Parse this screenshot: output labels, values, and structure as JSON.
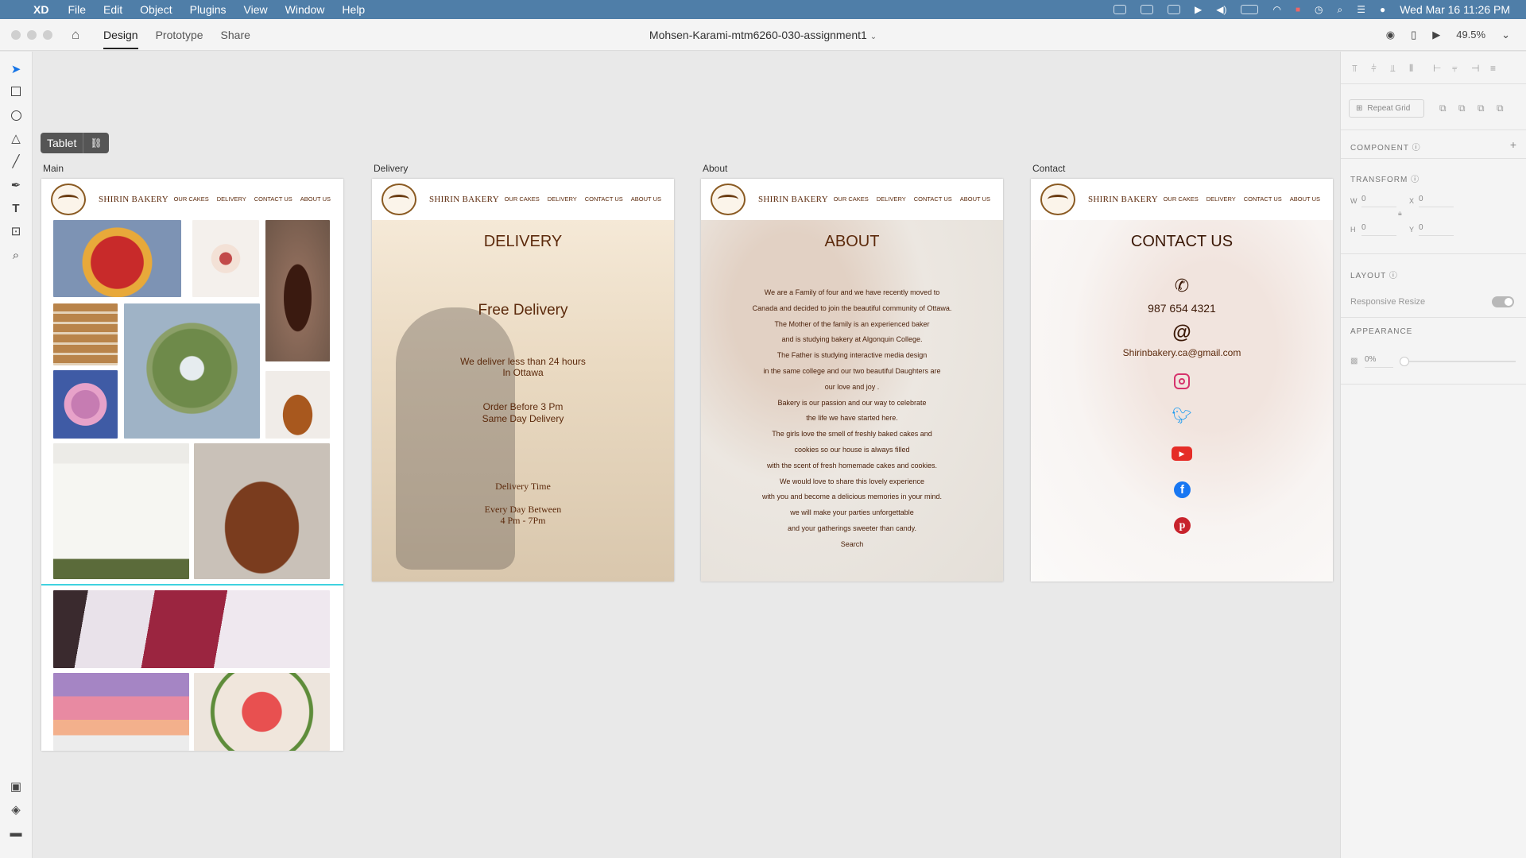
{
  "menubar": {
    "app": "XD",
    "items": [
      "File",
      "Edit",
      "Object",
      "Plugins",
      "View",
      "Window",
      "Help"
    ],
    "datetime": "Wed Mar 16  11:26 PM"
  },
  "toolbar": {
    "modes": [
      "Design",
      "Prototype",
      "Share"
    ],
    "doc_title": "Mohsen-Karami-mtm6260-030-assignment1",
    "zoom": "49.5%"
  },
  "tablet_tag": {
    "label": "Tablet"
  },
  "site": {
    "brand": "SHIRIN BAKERY",
    "nav": [
      "OUR CAKES",
      "DELIVERY",
      "CONTACT US",
      "ABOUT US"
    ]
  },
  "artboards": {
    "main": {
      "label": "Main"
    },
    "delivery": {
      "label": "Delivery",
      "heading": "DELIVERY",
      "subheading": "Free Delivery",
      "line1": "We deliver less than 24 hours",
      "line2": "In Ottawa",
      "line3": "Order Before 3 Pm",
      "line4": "Same Day Delivery",
      "time_title": "Delivery Time",
      "time_line1": "Every Day Between",
      "time_line2": "4 Pm - 7Pm"
    },
    "about": {
      "label": "About",
      "heading": "ABOUT",
      "paragraph": [
        "We are a Family of four and we have recently moved to",
        "Canada and decided to join the beautiful community of Ottawa.",
        "The Mother of the family is an experienced baker",
        "and is studying bakery at Algonquin College.",
        "The Father is studying interactive media design",
        "in the same college and our two beautiful Daughters are",
        "our love and joy .",
        "Bakery is our passion and our way to celebrate",
        "the life we have started here.",
        "The girls love the smell of freshly baked cakes and",
        "cookies so our house is always filled",
        "with the scent of fresh homemade cakes and cookies.",
        "We would love to share this lovely experience",
        "with you and become a delicious memories in your mind.",
        "we will make your parties unforgettable",
        "and your gatherings sweeter than candy.",
        "Search"
      ]
    },
    "contact": {
      "label": "Contact",
      "heading": "CONTACT US",
      "phone": "987 654 4321",
      "email": "Shirinbakery.ca@gmail.com",
      "icons": [
        "phone-icon",
        "at-icon",
        "instagram-icon",
        "twitter-icon",
        "youtube-icon",
        "facebook-icon",
        "pinterest-icon"
      ]
    }
  },
  "panel": {
    "repeat_grid": "Repeat Grid",
    "component": "COMPONENT",
    "transform": "TRANSFORM",
    "w_label": "W",
    "w_value": "0",
    "x_label": "X",
    "x_value": "0",
    "h_label": "H",
    "h_value": "0",
    "y_label": "Y",
    "y_value": "0",
    "layout": "LAYOUT",
    "responsive_resize": "Responsive Resize",
    "appearance": "APPEARANCE",
    "opacity": "0%"
  },
  "colors": {
    "menubar": "#4f7ea8",
    "brand_brown": "#5c2a0c",
    "instagram": "#d6336c",
    "twitter": "#1d9bf0",
    "youtube": "#e52d27",
    "facebook": "#1877f2",
    "pinterest": "#c8232c"
  }
}
